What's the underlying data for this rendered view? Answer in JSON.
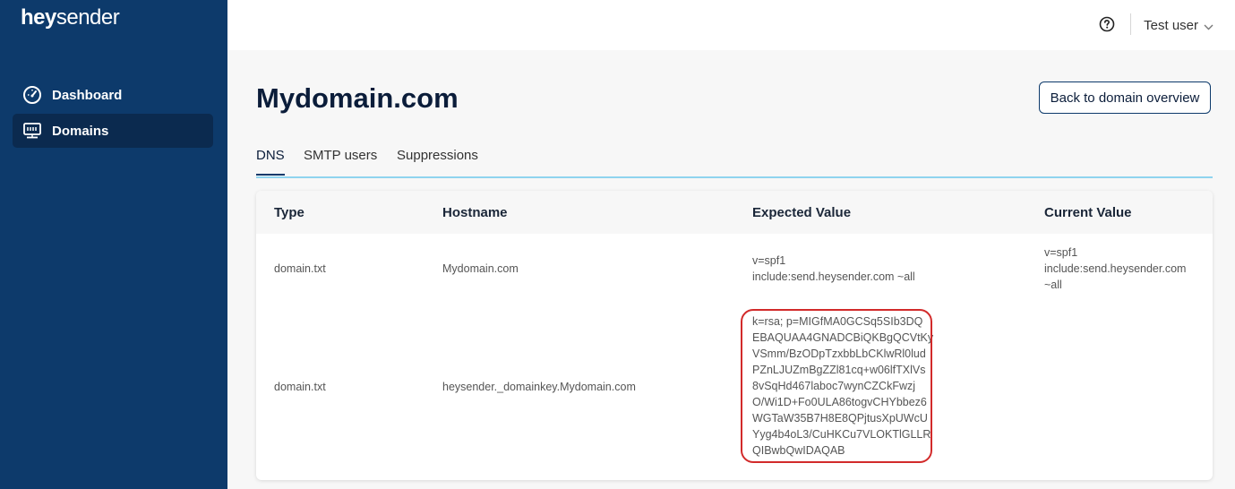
{
  "app": {
    "logo_bold": "hey",
    "logo_light": "sender"
  },
  "sidebar": {
    "items": [
      {
        "label": "Dashboard",
        "icon": "dashboard-gauge-icon",
        "active": false
      },
      {
        "label": "Domains",
        "icon": "domains-server-icon",
        "active": true
      }
    ]
  },
  "topbar": {
    "help_icon": "question-circle-icon",
    "user_name": "Test user"
  },
  "page": {
    "title": "Mydomain.com",
    "back_button": "Back to domain overview"
  },
  "tabs": [
    {
      "label": "DNS",
      "active": true
    },
    {
      "label": "SMTP users",
      "active": false
    },
    {
      "label": "Suppressions",
      "active": false
    }
  ],
  "table": {
    "headers": [
      "Type",
      "Hostname",
      "Expected Value",
      "Current Value"
    ],
    "rows": [
      {
        "type": "domain.txt",
        "hostname": "Mydomain.com",
        "expected": [
          "v=spf1",
          "include:send.heysender.com ~all"
        ],
        "current": [
          "v=spf1",
          "include:send.heysender.com",
          "~all"
        ]
      },
      {
        "type": "domain.txt",
        "hostname": "heysender._domainkey.Mydomain.com",
        "expected": [
          "k=rsa; p=MIGfMA0GCSq5SIb3DQ",
          "EBAQUAA4GNADCBiQKBgQCVtKy",
          "VSmm/BzODpTzxbbLbCKlwRl0lud",
          "PZnLJUZmBgZZl81cq+w06lfTXlVs",
          "8vSqHd467laboc7wynCZCkFwzj",
          "O/Wi1D+Fo0ULA86togvCHYbbez6",
          "WGTaW35B7H8E8QPjtusXpUWcU",
          "Yyg4b4oL3/CuHKCu7VLOKTlGLLR",
          "QIBwbQwIDAQAB"
        ],
        "current": []
      }
    ]
  },
  "colors": {
    "sidebar_bg": "#0d3a6b",
    "sidebar_active_bg": "#0b2a4f",
    "tab_underline": "#8fd4ef",
    "highlight_border": "#d22a2a"
  }
}
